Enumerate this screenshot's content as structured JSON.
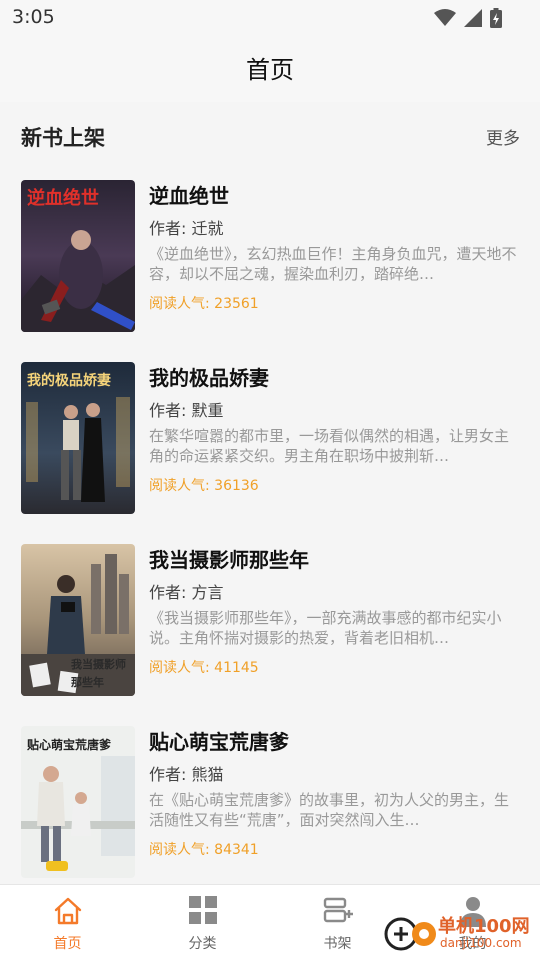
{
  "status_bar": {
    "time": "3:05"
  },
  "header": {
    "title": "首页"
  },
  "section": {
    "title": "新书上架",
    "more": "更多"
  },
  "books": [
    {
      "title": "逆血绝世",
      "author": "作者: 迁就",
      "description": "《逆血绝世》，玄幻热血巨作！主角身负血咒，遭天地不容，却以不屈之魂，握染血利刃，踏碎绝…",
      "popularity": "阅读人气: 23561",
      "cover_text": "逆血绝世"
    },
    {
      "title": "我的极品娇妻",
      "author": "作者: 默重",
      "description": "在繁华喧嚣的都市里，一场看似偶然的相遇，让男女主角的命运紧紧交织。男主角在职场中披荆斩…",
      "popularity": "阅读人气: 36136",
      "cover_text": "我的极品娇妻"
    },
    {
      "title": "我当摄影师那些年",
      "author": "作者: 方言",
      "description": "《我当摄影师那些年》，一部充满故事感的都市纪实小说。主角怀揣对摄影的热爱，背着老旧相机…",
      "popularity": "阅读人气: 41145",
      "cover_text": "我当摄影师那些年"
    },
    {
      "title": "贴心萌宝荒唐爹",
      "author": "作者: 熊猫",
      "description": "在《贴心萌宝荒唐爹》的故事里，初为人父的男主，生活随性又有些“荒唐”，面对突然闯入生…",
      "popularity": "阅读人气: 84341",
      "cover_text": "贴心萌宝荒唐爹"
    }
  ],
  "tabs": [
    {
      "label": "首页",
      "icon": "home-icon",
      "active": true
    },
    {
      "label": "分类",
      "icon": "category-grid-icon",
      "active": false
    },
    {
      "label": "书架",
      "icon": "bookshelf-icon",
      "active": false
    },
    {
      "label": "我的",
      "icon": "profile-icon",
      "active": false
    }
  ],
  "watermark": {
    "line1": "单机100网",
    "line2": "danji100.com"
  },
  "colors": {
    "accent": "#f47a2a",
    "popularity": "#f0a028",
    "background": "#f5f5f5"
  }
}
